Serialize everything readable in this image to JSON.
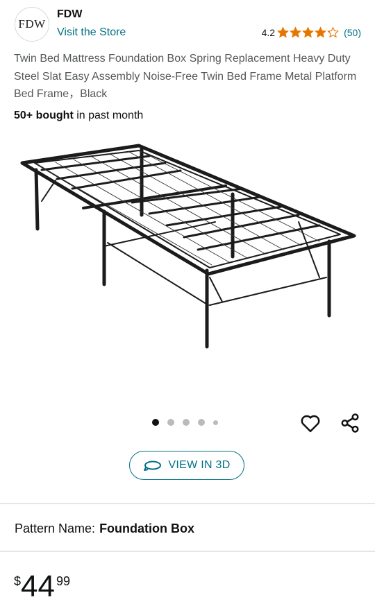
{
  "brand": {
    "logo_text": "FDW",
    "name": "FDW",
    "store_link": "Visit the Store"
  },
  "rating": {
    "value": "4.2",
    "stars": 4.2,
    "count": "(50)",
    "star_color": "#e77600"
  },
  "product": {
    "title": "Twin Bed Mattress Foundation Box Spring Replacement Heavy Duty Steel Slat Easy Assembly Noise-Free Twin Bed Frame Metal Platform Bed Frame，Black",
    "bought_bold": "50+ bought",
    "bought_rest": " in past month"
  },
  "gallery": {
    "image_count": 5,
    "active_index": 0,
    "view_3d_label": "VIEW IN 3D"
  },
  "pattern": {
    "label": "Pattern Name:",
    "value": "Foundation Box"
  },
  "price": {
    "symbol": "$",
    "whole": "44",
    "fraction": "99"
  },
  "colors": {
    "link": "#007185",
    "text": "#0f1111",
    "muted": "#565959"
  }
}
